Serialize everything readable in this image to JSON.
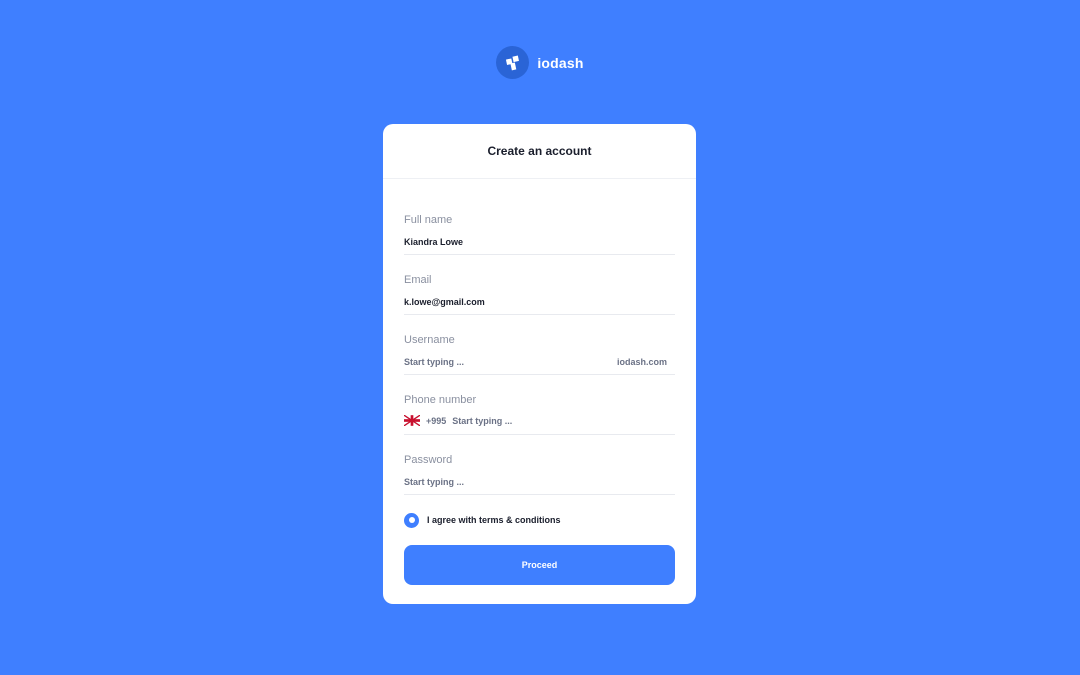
{
  "brand": {
    "name": "iodash",
    "logo_icon": "iodash-logo-icon"
  },
  "card": {
    "title": "Create an account"
  },
  "form": {
    "full_name": {
      "label": "Full name",
      "value": "Kiandra Lowe"
    },
    "email": {
      "label": "Email",
      "value": "k.lowe@gmail.com"
    },
    "username": {
      "label": "Username",
      "placeholder": "Start typing ...",
      "suffix": "iodash.com"
    },
    "phone": {
      "label": "Phone number",
      "flag_icon": "uk-flag-icon",
      "country_code": "+995",
      "placeholder": "Start typing ..."
    },
    "password": {
      "label": "Password",
      "placeholder": "Start typing ..."
    }
  },
  "terms": {
    "label": "I agree with terms & conditions",
    "checked": true
  },
  "actions": {
    "proceed_label": "Proceed"
  },
  "colors": {
    "background": "#3F7FFF",
    "accent": "#3F7FFF",
    "logo_badge": "#2A64D6",
    "card": "#FFFFFF"
  }
}
